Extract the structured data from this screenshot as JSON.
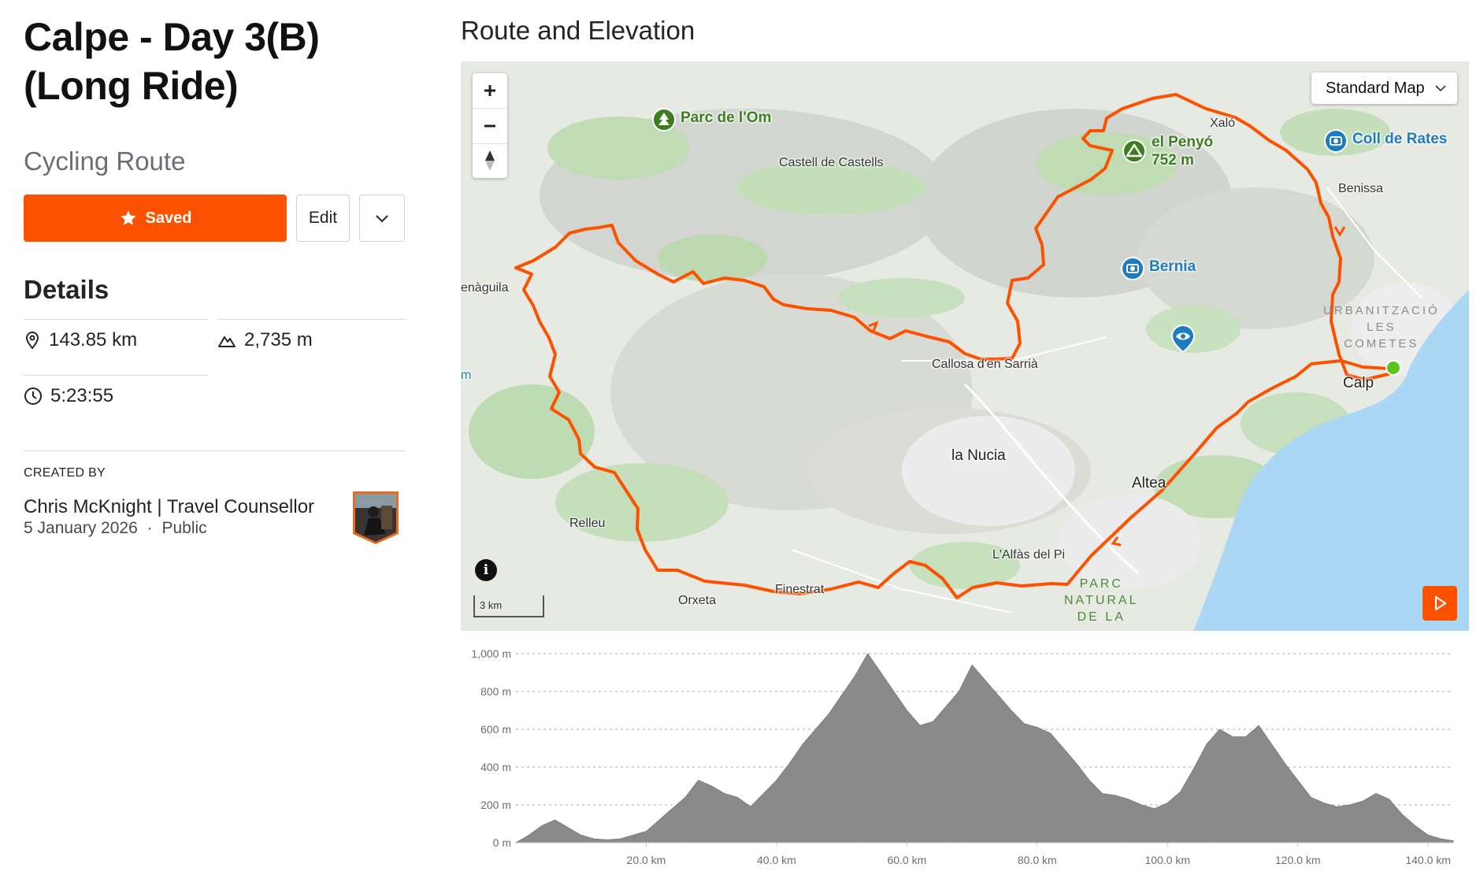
{
  "route": {
    "title": "Calpe - Day 3(B) (Long Ride)",
    "subtitle": "Cycling Route"
  },
  "actions": {
    "saved_label": "Saved",
    "edit_label": "Edit"
  },
  "details": {
    "heading": "Details",
    "distance": "143.85 km",
    "elevation_gain": "2,735 m",
    "moving_time": "5:23:55"
  },
  "creator": {
    "label": "CREATED BY",
    "name": "Chris McKnight | Travel Counsellor",
    "date": "5 January 2026",
    "separator": "·",
    "visibility": "Public"
  },
  "section": {
    "title": "Route and Elevation"
  },
  "map": {
    "type_selector": "Standard Map",
    "scale_label": "3 km",
    "info_label": "i",
    "places": {
      "castell_de_castells": "Castell de Castells",
      "xalo": "Xaló",
      "benissa": "Benissa",
      "callosa": "Callosa d'en Sarrià",
      "la_nucia": "la Nucia",
      "altea": "Altea",
      "calp": "Calp",
      "relleu": "Relleu",
      "orxeta": "Orxeta",
      "finestrat": "Finestrat",
      "alfas": "L'Alfàs del Pi",
      "penaguila": "enàguila",
      "edge_m": "m"
    },
    "pois": {
      "parc_de_lom": "Parc de l'Om",
      "el_penyo": "el Penyó",
      "el_penyo_elev": "752 m",
      "coll_de_rates": "Coll de Rates",
      "bernia": "Bernia"
    },
    "areas": {
      "urbanitzacio_1": "URBANITZACIÓ",
      "urbanitzacio_2": "LES",
      "urbanitzacio_3": "COMETES",
      "parc_1": "PARC",
      "parc_2": "NATURAL",
      "parc_3": "DE LA"
    },
    "colors": {
      "route": "#fc5200",
      "start_marker": "#5ac31c",
      "water": "#a9d7f4",
      "poi_green": "#3c7e1f",
      "poi_blue": "#1e7bc2"
    }
  },
  "chart_data": {
    "type": "area",
    "title": "",
    "xlabel": "",
    "ylabel": "",
    "xlim": [
      0,
      143.85
    ],
    "ylim": [
      0,
      1000
    ],
    "x_ticks": [
      20,
      40,
      60,
      80,
      100,
      120,
      140
    ],
    "x_tick_labels": [
      "20.0 km",
      "40.0 km",
      "60.0 km",
      "80.0 km",
      "100.0 km",
      "120.0 km",
      "140.0 km"
    ],
    "y_ticks": [
      0,
      200,
      400,
      600,
      800,
      1000
    ],
    "y_tick_labels": [
      "0 m",
      "200 m",
      "400 m",
      "600 m",
      "800 m",
      "1,000 m"
    ],
    "grid": "horizontal dotted",
    "fill_color": "#8a8a8a",
    "series": [
      {
        "x": [
          0,
          2,
          4,
          6,
          8,
          10,
          12,
          14,
          16,
          18,
          20,
          22,
          24,
          26,
          28,
          30,
          32,
          34,
          36,
          38,
          40,
          42,
          44,
          46,
          48,
          50,
          52,
          54,
          56,
          58,
          60,
          62,
          64,
          66,
          68,
          70,
          72,
          74,
          76,
          78,
          80,
          82,
          84,
          86,
          88,
          90,
          92,
          94,
          96,
          98,
          100,
          102,
          104,
          106,
          108,
          110,
          112,
          114,
          116,
          118,
          120,
          122,
          124,
          126,
          128,
          130,
          132,
          134,
          136,
          138,
          140,
          142,
          143.85
        ],
        "y": [
          0,
          40,
          90,
          120,
          80,
          40,
          20,
          15,
          20,
          40,
          60,
          120,
          180,
          240,
          330,
          300,
          260,
          240,
          190,
          260,
          330,
          420,
          520,
          600,
          680,
          780,
          880,
          1000,
          900,
          800,
          700,
          620,
          640,
          720,
          800,
          940,
          860,
          780,
          700,
          630,
          610,
          580,
          500,
          420,
          330,
          260,
          250,
          230,
          200,
          180,
          210,
          270,
          390,
          520,
          600,
          560,
          560,
          620,
          520,
          420,
          330,
          240,
          210,
          190,
          200,
          220,
          260,
          230,
          150,
          90,
          40,
          20,
          10
        ]
      }
    ]
  }
}
